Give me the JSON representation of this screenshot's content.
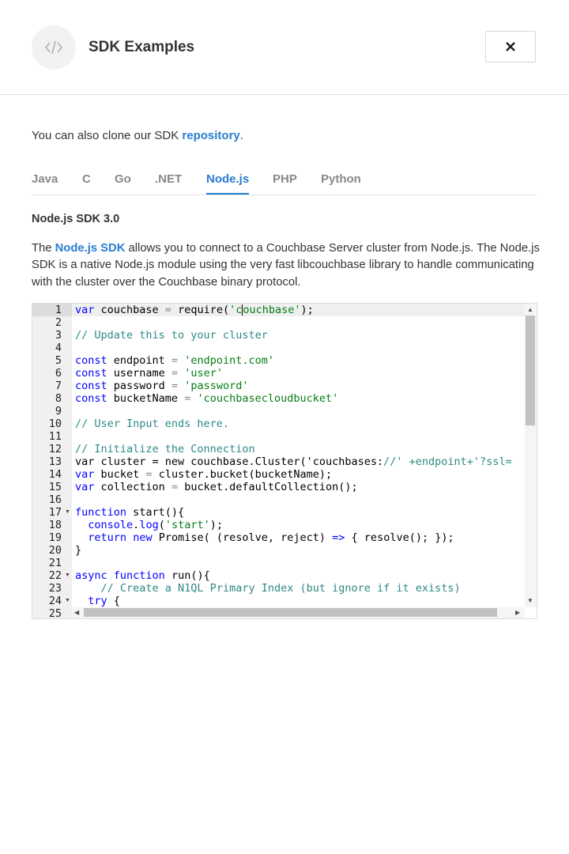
{
  "header": {
    "title": "SDK Examples",
    "icon": "code-icon",
    "close_icon": "close-icon"
  },
  "intro": {
    "text_before": "You can also clone our SDK ",
    "link": "repository",
    "text_after": "."
  },
  "tabs": [
    {
      "label": "Java",
      "active": false
    },
    {
      "label": "C",
      "active": false
    },
    {
      "label": "Go",
      "active": false
    },
    {
      "label": ".NET",
      "active": false
    },
    {
      "label": "Node.js",
      "active": true
    },
    {
      "label": "PHP",
      "active": false
    },
    {
      "label": "Python",
      "active": false
    }
  ],
  "section": {
    "title": "Node.js SDK 3.0",
    "desc_before": "The ",
    "desc_link": "Node.js SDK",
    "desc_after": " allows you to connect to a Couchbase Server cluster from Node.js. The Node.js SDK is a native Node.js module using the very fast libcouchbase library to handle communicating with the cluster over the Couchbase binary protocol."
  },
  "editor": {
    "line_numbers": [
      "1",
      "2",
      "3",
      "4",
      "5",
      "6",
      "7",
      "8",
      "9",
      "10",
      "11",
      "12",
      "13",
      "14",
      "15",
      "16",
      "17",
      "18",
      "19",
      "20",
      "21",
      "22",
      "23",
      "24",
      "25"
    ],
    "fold_lines": [
      "17",
      "22",
      "24"
    ],
    "lines": [
      "var couchbase = require('couchbase');",
      "",
      "// Update this to your cluster",
      "",
      "const endpoint = 'endpoint.com'",
      "const username = 'user'",
      "const password = 'password'",
      "const bucketName = 'couchbasecloudbucket'",
      "",
      "// User Input ends here.",
      "",
      "// Initialize the Connection",
      "var cluster = new couchbase.Cluster('couchbases://' +endpoint+'?ssl=",
      "var bucket = cluster.bucket(bucketName);",
      "var collection = bucket.defaultCollection();",
      "",
      "function start(){",
      "  console.log('start');",
      "  return new Promise( (resolve, reject) => { resolve(); });",
      "}",
      "",
      "async function run(){",
      "    // Create a N1QL Primary Index (but ignore if it exists)",
      "  try {",
      ""
    ]
  },
  "colors": {
    "accent": "#2a7dd2",
    "keyword": "#0000ff",
    "string": "#067d17",
    "comment": "#2d8a84"
  }
}
